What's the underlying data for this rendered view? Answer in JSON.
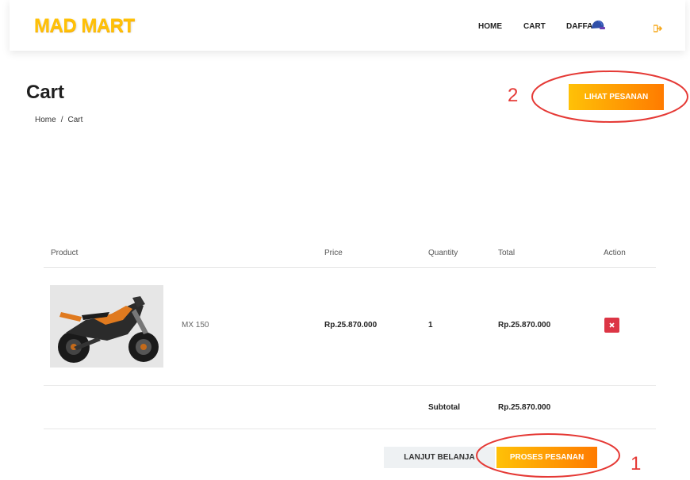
{
  "nav": {
    "brand": "MAD MART",
    "links": [
      "HOME",
      "CART"
    ],
    "user": "DAFFA"
  },
  "page": {
    "title": "Cart",
    "breadcrumb": [
      "Home",
      "Cart"
    ],
    "view_orders_button": "LIHAT PESANAN"
  },
  "table": {
    "headers": [
      "Product",
      "Price",
      "Quantity",
      "Total",
      "Action"
    ],
    "rows": [
      {
        "product_name": "MX 150",
        "price": "Rp.25.870.000",
        "quantity": "1",
        "total": "Rp.25.870.000"
      }
    ],
    "subtotal_label": "Subtotal",
    "subtotal_value": "Rp.25.870.000"
  },
  "actions": {
    "continue_shopping": "LANJUT BELANJA",
    "process_order": "PROSES PESANAN"
  },
  "annotations": [
    "2",
    "1"
  ],
  "colors": {
    "brand": "#ffc107",
    "button_gradient_start": "#ffc107",
    "button_gradient_end": "#ff7b00",
    "delete": "#dc3545",
    "annotation": "#e53935"
  },
  "icons": {
    "avatar": "user-avatar-icon",
    "logout": "logout-icon",
    "delete": "close-x-icon"
  }
}
